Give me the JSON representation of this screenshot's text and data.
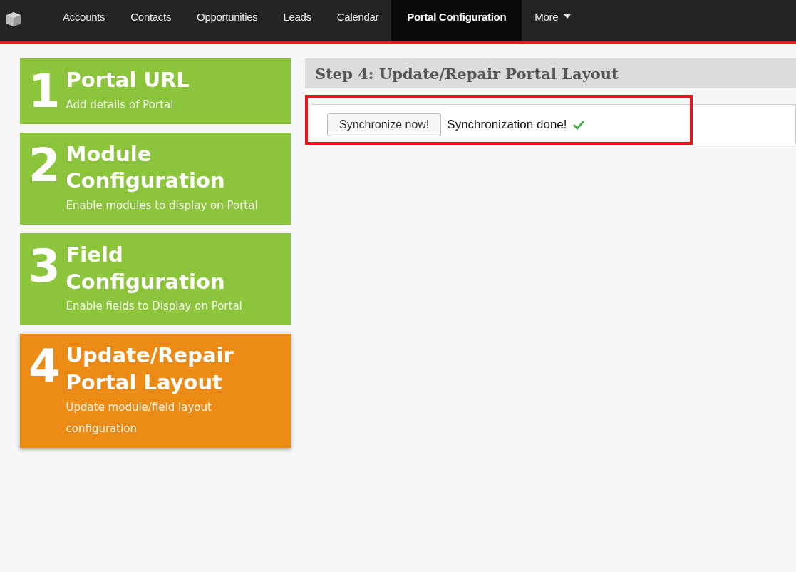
{
  "nav": {
    "items": [
      {
        "label": "Accounts",
        "selected": false
      },
      {
        "label": "Contacts",
        "selected": false
      },
      {
        "label": "Opportunities",
        "selected": false
      },
      {
        "label": "Leads",
        "selected": false
      },
      {
        "label": "Calendar",
        "selected": false
      },
      {
        "label": "Portal Configuration",
        "selected": true
      },
      {
        "label": "More",
        "selected": false,
        "kind": "dropdown"
      }
    ]
  },
  "steps": [
    {
      "number": "1",
      "title": "Portal URL",
      "description": "Add details of Portal",
      "selected": false
    },
    {
      "number": "2",
      "title": "Module Configuration",
      "description": "Enable modules to display on Portal",
      "selected": false
    },
    {
      "number": "3",
      "title": "Field Configuration",
      "description": "Enable fields to Display on Portal",
      "selected": false
    },
    {
      "number": "4",
      "title": "Update/Repair Portal Layout",
      "description": "Update module/field layout configuration",
      "selected": true
    }
  ],
  "panel": {
    "title": "Step 4: Update/Repair Portal Layout",
    "button": "Synchronize now!",
    "status": "Synchronization done!",
    "done": true,
    "highlighted": true
  }
}
